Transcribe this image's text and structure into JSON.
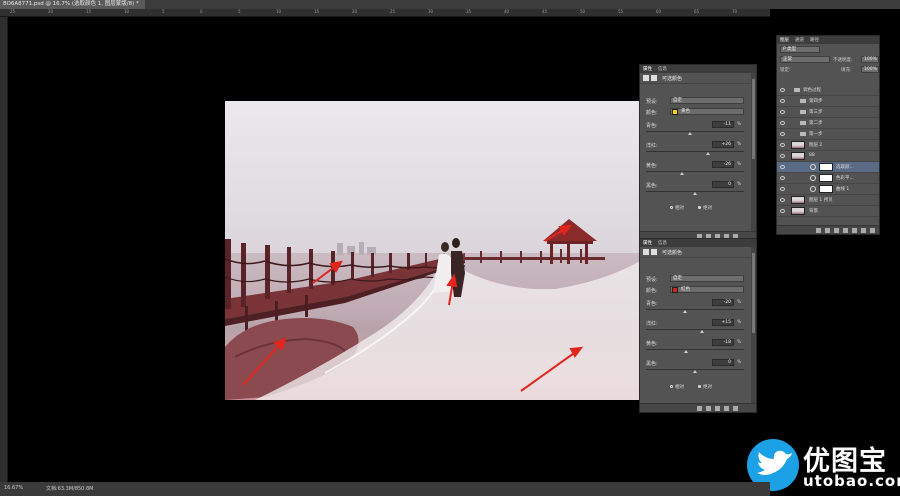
{
  "document": {
    "tab_title": "8O6A8771.psd @ 16.7% (选取颜色 1, 图层蒙版/8) *"
  },
  "ruler_labels": [
    "25",
    "20",
    "15",
    "10",
    "5",
    "0",
    "5",
    "10",
    "15",
    "20",
    "25",
    "30",
    "35",
    "40",
    "45",
    "50",
    "55",
    "60",
    "65",
    "70"
  ],
  "properties_panel_top": {
    "tabs": [
      "属性",
      "信息"
    ],
    "title": "可选颜色",
    "preset_label": "预设:",
    "preset_value": "自定",
    "colors_label": "颜色:",
    "colors_value": "黄色",
    "swatch_color": "#f4d200",
    "sliders": [
      {
        "label": "青色:",
        "value": "-11",
        "position": -11
      },
      {
        "label": "洋红:",
        "value": "+26",
        "position": 26
      },
      {
        "label": "黄色:",
        "value": "-26",
        "position": -26
      },
      {
        "label": "黑色:",
        "value": "0",
        "position": 0
      }
    ],
    "method_relative": "相对",
    "method_absolute": "绝对",
    "method_selected": "absolute"
  },
  "properties_panel_bottom": {
    "tabs": [
      "属性",
      "信息"
    ],
    "title": "可选颜色",
    "preset_label": "预设:",
    "preset_value": "自定",
    "colors_label": "颜色:",
    "colors_value": "红色",
    "swatch_color": "#c8281e",
    "sliders": [
      {
        "label": "青色:",
        "value": "-20",
        "position": -20
      },
      {
        "label": "洋红:",
        "value": "+15",
        "position": 15
      },
      {
        "label": "黄色:",
        "value": "-18",
        "position": -18
      },
      {
        "label": "黑色:",
        "value": "0",
        "position": 0
      }
    ],
    "method_relative": "相对",
    "method_absolute": "绝对",
    "method_selected": "absolute"
  },
  "percent_sign": "%",
  "layers_panel": {
    "tabs": [
      "图层",
      "通道",
      "路径"
    ],
    "filter_label": "P 类型",
    "blend_mode": "正常",
    "opacity_label": "不透明度:",
    "opacity_value": "100%",
    "lock_label": "锁定:",
    "fill_label": "填充:",
    "fill_value": "100%",
    "groups": [
      {
        "name": "调色过程",
        "level": 0
      },
      {
        "name": "第四步",
        "level": 1
      },
      {
        "name": "第三步",
        "level": 1
      },
      {
        "name": "第二步",
        "level": 1
      },
      {
        "name": "第一步",
        "level": 1
      }
    ],
    "layers": [
      {
        "name": "图层 2",
        "kind": "image"
      },
      {
        "name": "88",
        "kind": "image"
      },
      {
        "name": "选取颜...",
        "kind": "adjustment",
        "selected": true
      },
      {
        "name": "色彩平...",
        "kind": "adjustment"
      },
      {
        "name": "曲线 1",
        "kind": "adjustment"
      },
      {
        "name": "图层 1 拷贝",
        "kind": "image"
      },
      {
        "name": "背景",
        "kind": "image"
      }
    ]
  },
  "status": {
    "zoom": "16.67%",
    "doc_size": "文档:63.3M/850.8M"
  },
  "watermark": {
    "chinese": "优图宝",
    "domain": "utobao.com",
    "brand_color": "#1da1e6"
  }
}
